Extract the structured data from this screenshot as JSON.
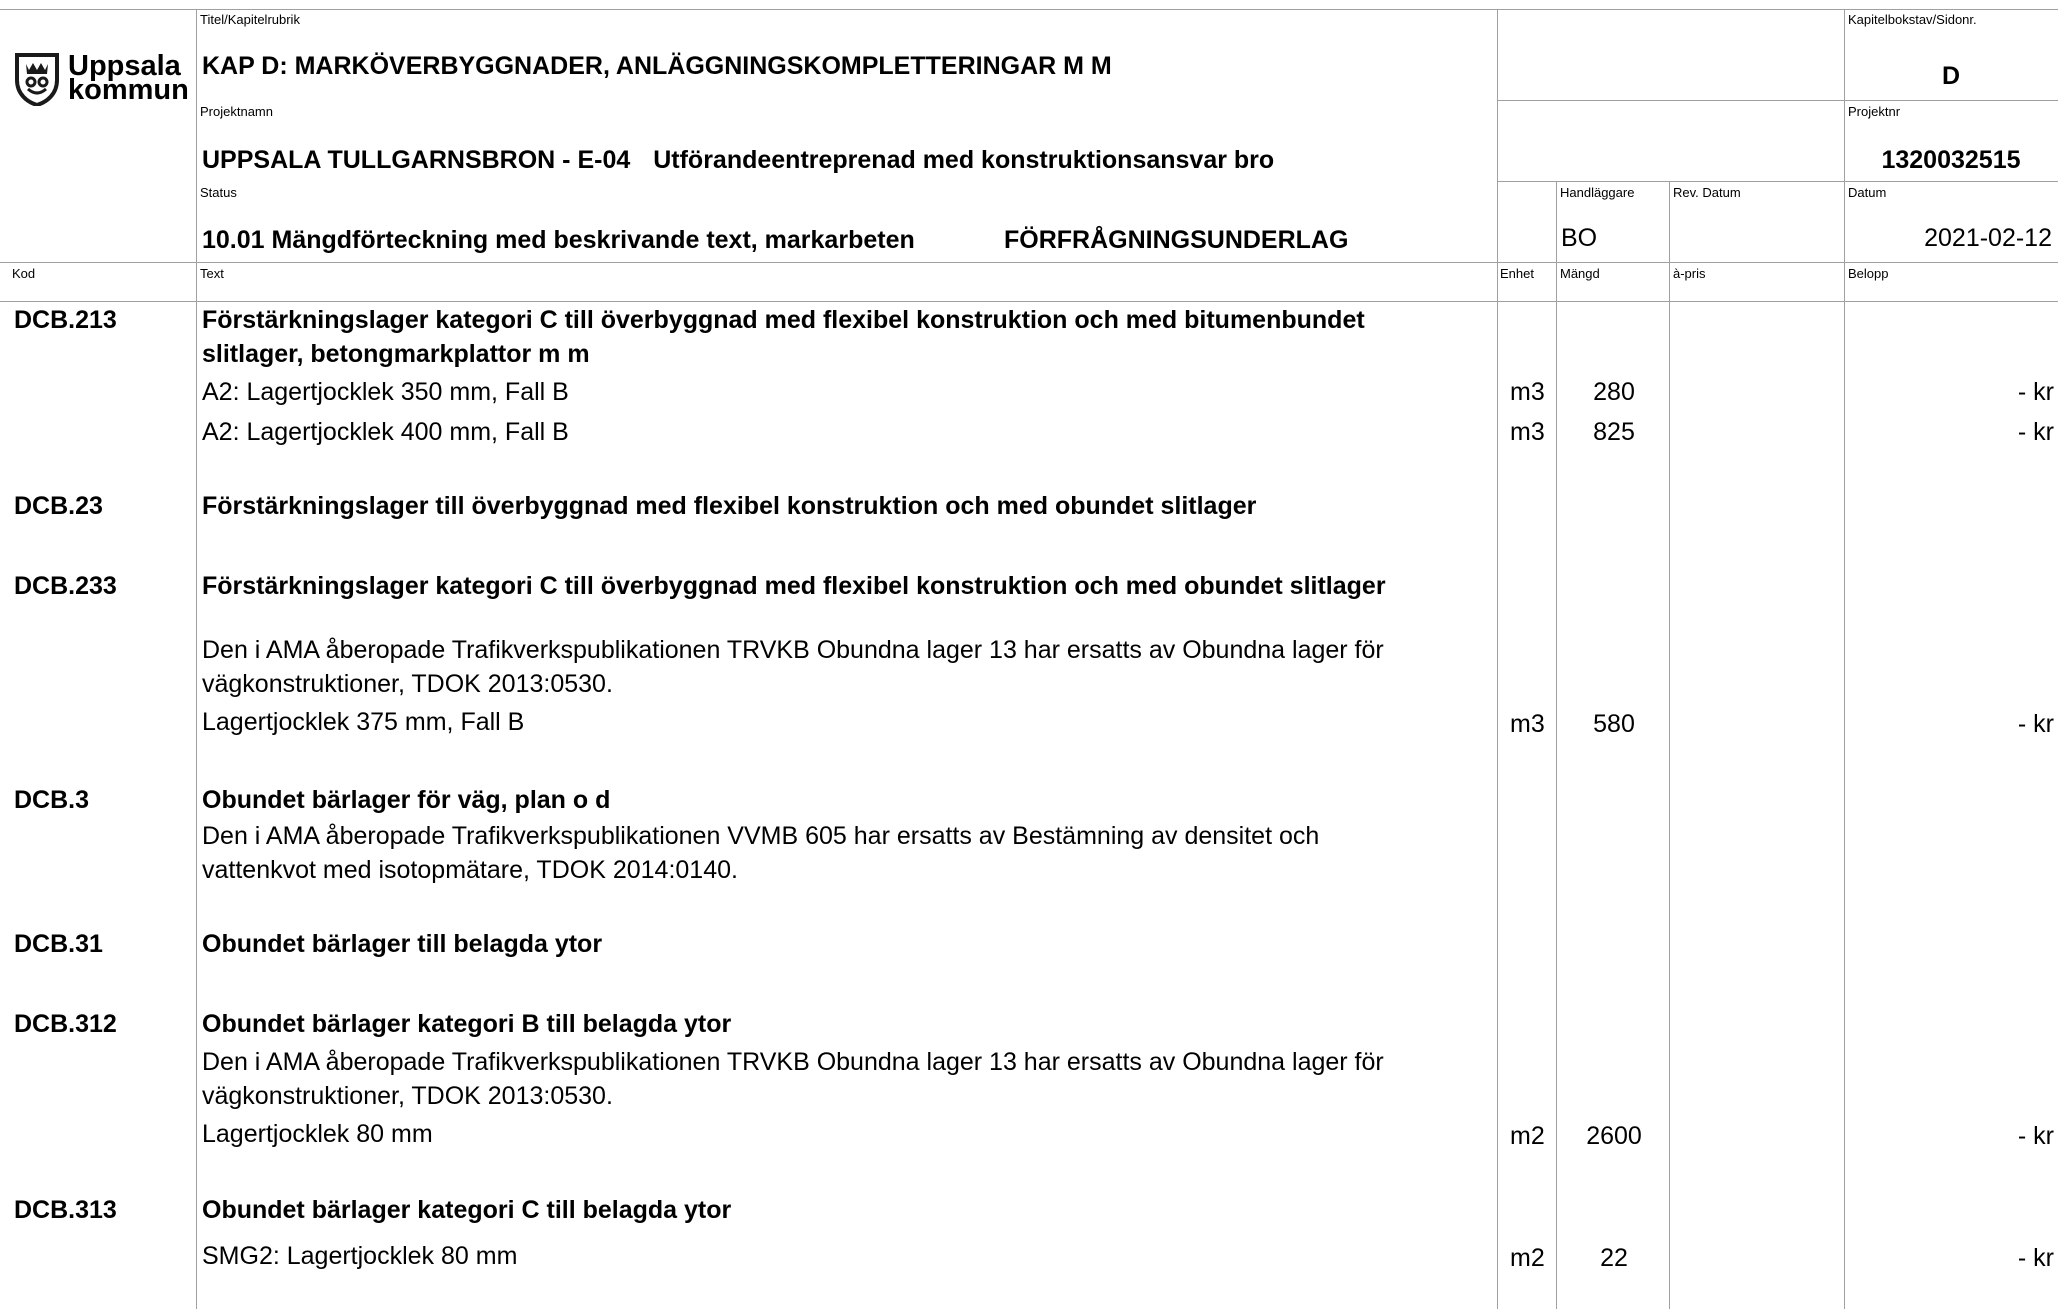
{
  "header": {
    "title_label": "Titel/Kapitelrubrik",
    "title": "KAP D: MARKÖVERBYGGNADER, ANLÄGGNINGSKOMPLETTERINGAR M M",
    "project_name_label": "Projektnamn",
    "project_name_bold": "UPPSALA TULLGARNSBRON - E-04",
    "project_name_rest": "Utförandeentreprenad med konstruktionsansvar bro",
    "status_label": "Status",
    "status": "10.01 Mängdförteckning med beskrivande text, markarbeten",
    "status_tag": "FÖRFRÅGNINGSUNDERLAG",
    "chapter_label": "Kapitelbokstav/Sidonr.",
    "chapter": "D",
    "project_no_label": "Projektnr",
    "project_no": "1320032515",
    "handler_label": "Handläggare",
    "handler": "BO",
    "rev_date_label": "Rev. Datum",
    "date_label": "Datum",
    "date": "2021-02-12"
  },
  "logo": {
    "line1": "Uppsala",
    "line2": "kommun",
    "icon": "uppsala-crest-icon",
    "color": "#1a1a1a"
  },
  "columns": {
    "code": "Kod",
    "text": "Text",
    "unit": "Enhet",
    "quantity": "Mängd",
    "unit_price": "à-pris",
    "amount": "Belopp"
  },
  "rows": [
    {
      "code": "DCB.213",
      "line1": "Förstärkningslager kategori C till överbyggnad med flexibel konstruktion och med bitumenbundet",
      "line2": "slitlager, betongmarkplattor m m"
    },
    {
      "text": "A2: Lagertjocklek 350 mm, Fall B",
      "unit": "m3",
      "qty": "280",
      "amount": "- kr"
    },
    {
      "text": "A2: Lagertjocklek 400 mm, Fall B",
      "unit": "m3",
      "qty": "825",
      "amount": "- kr"
    },
    {
      "code": "DCB.23",
      "heading": "Förstärkningslager till överbyggnad med flexibel konstruktion och med obundet slitlager"
    },
    {
      "code": "DCB.233",
      "heading": "Förstärkningslager kategori C till överbyggnad med flexibel konstruktion och med obundet slitlager"
    },
    {
      "line1": "Den i AMA åberopade Trafikverkspublikationen TRVKB Obundna lager 13 har ersatts av Obundna lager för",
      "line2": "vägkonstruktioner, TDOK 2013:0530."
    },
    {
      "text": "Lagertjocklek 375 mm, Fall B",
      "unit": "m3",
      "qty": "580",
      "amount": "- kr"
    },
    {
      "code": "DCB.3",
      "heading": "Obundet bärlager för väg, plan o d"
    },
    {
      "line1": "Den i AMA åberopade Trafikverkspublikationen VVMB 605 har ersatts av Bestämning av densitet och",
      "line2": "vattenkvot med isotopmätare, TDOK 2014:0140."
    },
    {
      "code": "DCB.31",
      "heading": "Obundet bärlager till belagda ytor"
    },
    {
      "code": "DCB.312",
      "heading": "Obundet bärlager kategori B till belagda ytor"
    },
    {
      "line1": "Den i AMA åberopade Trafikverkspublikationen TRVKB Obundna lager 13 har ersatts av Obundna lager för",
      "line2": "vägkonstruktioner, TDOK 2013:0530."
    },
    {
      "text": "Lagertjocklek 80 mm",
      "unit": "m2",
      "qty": "2600",
      "amount": "- kr"
    },
    {
      "code": "DCB.313",
      "heading": "Obundet bärlager kategori C till belagda ytor"
    },
    {
      "text": "SMG2: Lagertjocklek 80 mm",
      "unit": "m2",
      "qty": "22",
      "amount": "- kr"
    }
  ]
}
